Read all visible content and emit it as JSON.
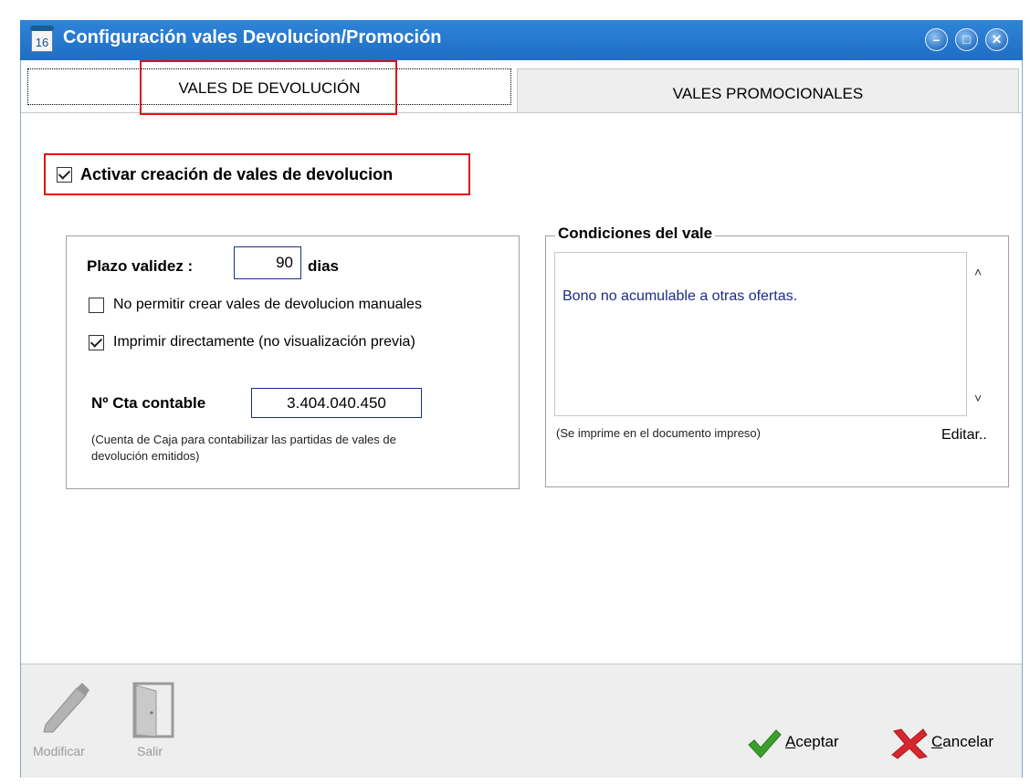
{
  "window": {
    "title": "Configuración vales Devolucion/Promoción",
    "app_icon_text": "16"
  },
  "window_controls": {
    "minimize": "–",
    "maximize": "□",
    "close": "✕"
  },
  "tabs": [
    {
      "label": "VALES DE DEVOLUCIÓN",
      "active": true
    },
    {
      "label": "VALES PROMOCIONALES",
      "active": false
    }
  ],
  "main": {
    "enable_checkbox": {
      "label": "Activar creación de vales de devolucion",
      "checked": true
    },
    "validity": {
      "label": "Plazo validez :",
      "value": "90",
      "unit": "dias"
    },
    "options": [
      {
        "label": "No permitir crear vales de devolucion manuales",
        "checked": false
      },
      {
        "label": "Imprimir directamente (no visualización previa)",
        "checked": true
      }
    ],
    "account": {
      "label": "Nº Cta contable",
      "value": "3.404.040.450",
      "note_line1": "(Cuenta de Caja para contabilizar las partidas de vales de",
      "note_line2": "devolución emitidos)"
    }
  },
  "conditions": {
    "legend": "Condiciones del vale",
    "text": "Bono no acumulable a otras ofertas.",
    "note": "(Se imprime en el documento impreso)",
    "edit_link": "Editar..",
    "scroll_up": "˄",
    "scroll_down": "˅"
  },
  "footer": {
    "modify_label": "Modificar",
    "exit_label": "Salir",
    "accept_label": "Aceptar",
    "cancel_label": "Cancelar"
  },
  "colors": {
    "titlebar": "#1e6ec4",
    "highlight": "#e01010",
    "field_border": "#1b2c8a",
    "memo_text": "#1b2c8a"
  }
}
